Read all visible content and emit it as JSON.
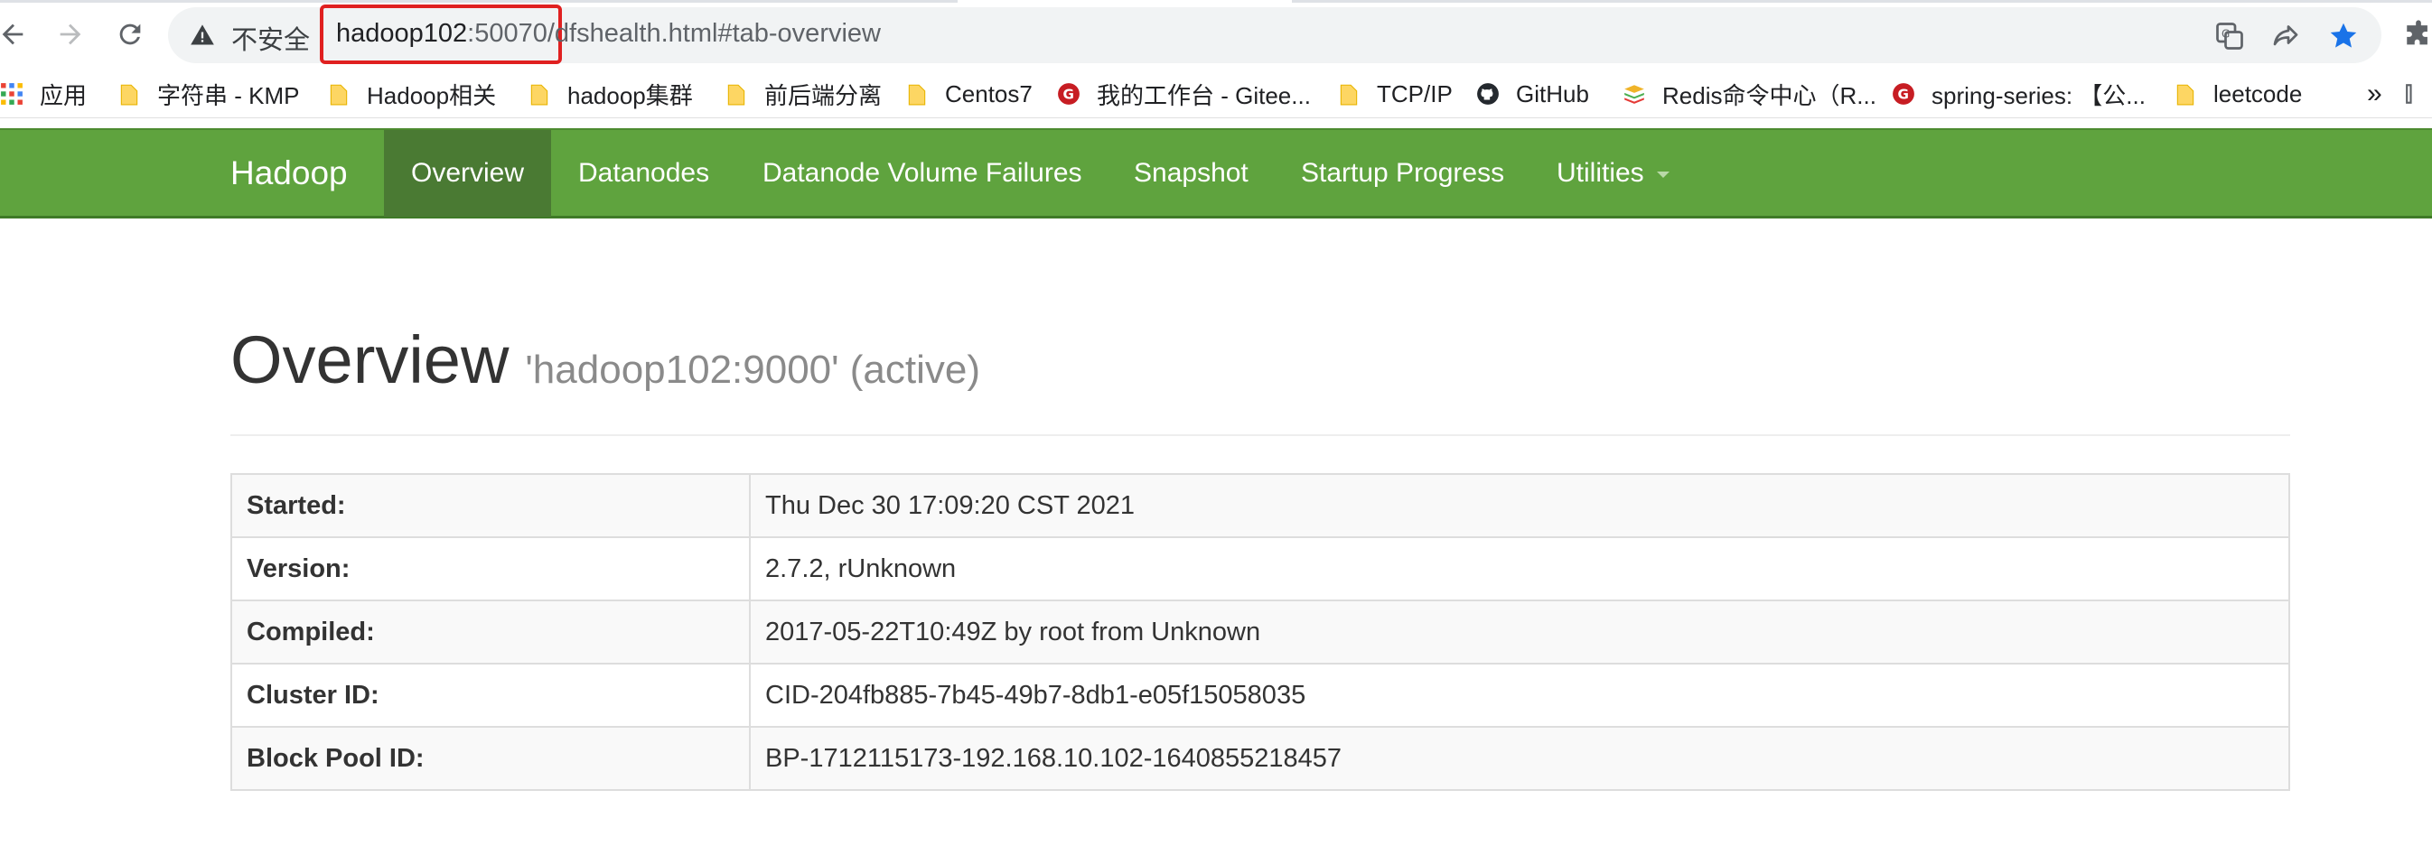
{
  "browser": {
    "security_label": "不安全",
    "url_host": "hadoop102",
    "url_port": ":50070",
    "url_path": "/dfshealth.html#tab-overview"
  },
  "bookmarks": [
    {
      "label": "应用",
      "icon": "apps-grid-icon"
    },
    {
      "label": "字符串 - KMP",
      "icon": "folder-icon"
    },
    {
      "label": "Hadoop相关",
      "icon": "folder-icon"
    },
    {
      "label": "hadoop集群",
      "icon": "folder-icon"
    },
    {
      "label": "前后端分离",
      "icon": "folder-icon"
    },
    {
      "label": "Centos7",
      "icon": "folder-icon"
    },
    {
      "label": "我的工作台 - Gitee...",
      "icon": "gitee-icon"
    },
    {
      "label": "TCP/IP",
      "icon": "folder-icon"
    },
    {
      "label": "GitHub",
      "icon": "github-icon"
    },
    {
      "label": "Redis命令中心（R...",
      "icon": "redis-icon"
    },
    {
      "label": "spring-series: 【公...",
      "icon": "gitee-icon"
    },
    {
      "label": "leetcode",
      "icon": "folder-icon"
    }
  ],
  "bookmarks_overflow": "»",
  "navbar": {
    "brand": "Hadoop",
    "items": [
      "Overview",
      "Datanodes",
      "Datanode Volume Failures",
      "Snapshot",
      "Startup Progress",
      "Utilities"
    ],
    "active_index": 0
  },
  "overview": {
    "title": "Overview",
    "subtitle": "'hadoop102:9000' (active)",
    "rows": [
      {
        "key": "Started:",
        "value": "Thu Dec 30 17:09:20 CST 2021"
      },
      {
        "key": "Version:",
        "value": "2.7.2, rUnknown"
      },
      {
        "key": "Compiled:",
        "value": "2017-05-22T10:49Z by root from Unknown"
      },
      {
        "key": "Cluster ID:",
        "value": "CID-204fb885-7b45-49b7-8db1-e05f15058035"
      },
      {
        "key": "Block Pool ID:",
        "value": "BP-1712115173-192.168.10.102-1640855218457"
      }
    ]
  },
  "colors": {
    "navbar_green": "#5fa33e",
    "navbar_active": "#4a7a33",
    "url_highlight": "#e02020",
    "star_blue": "#1a73e8"
  }
}
